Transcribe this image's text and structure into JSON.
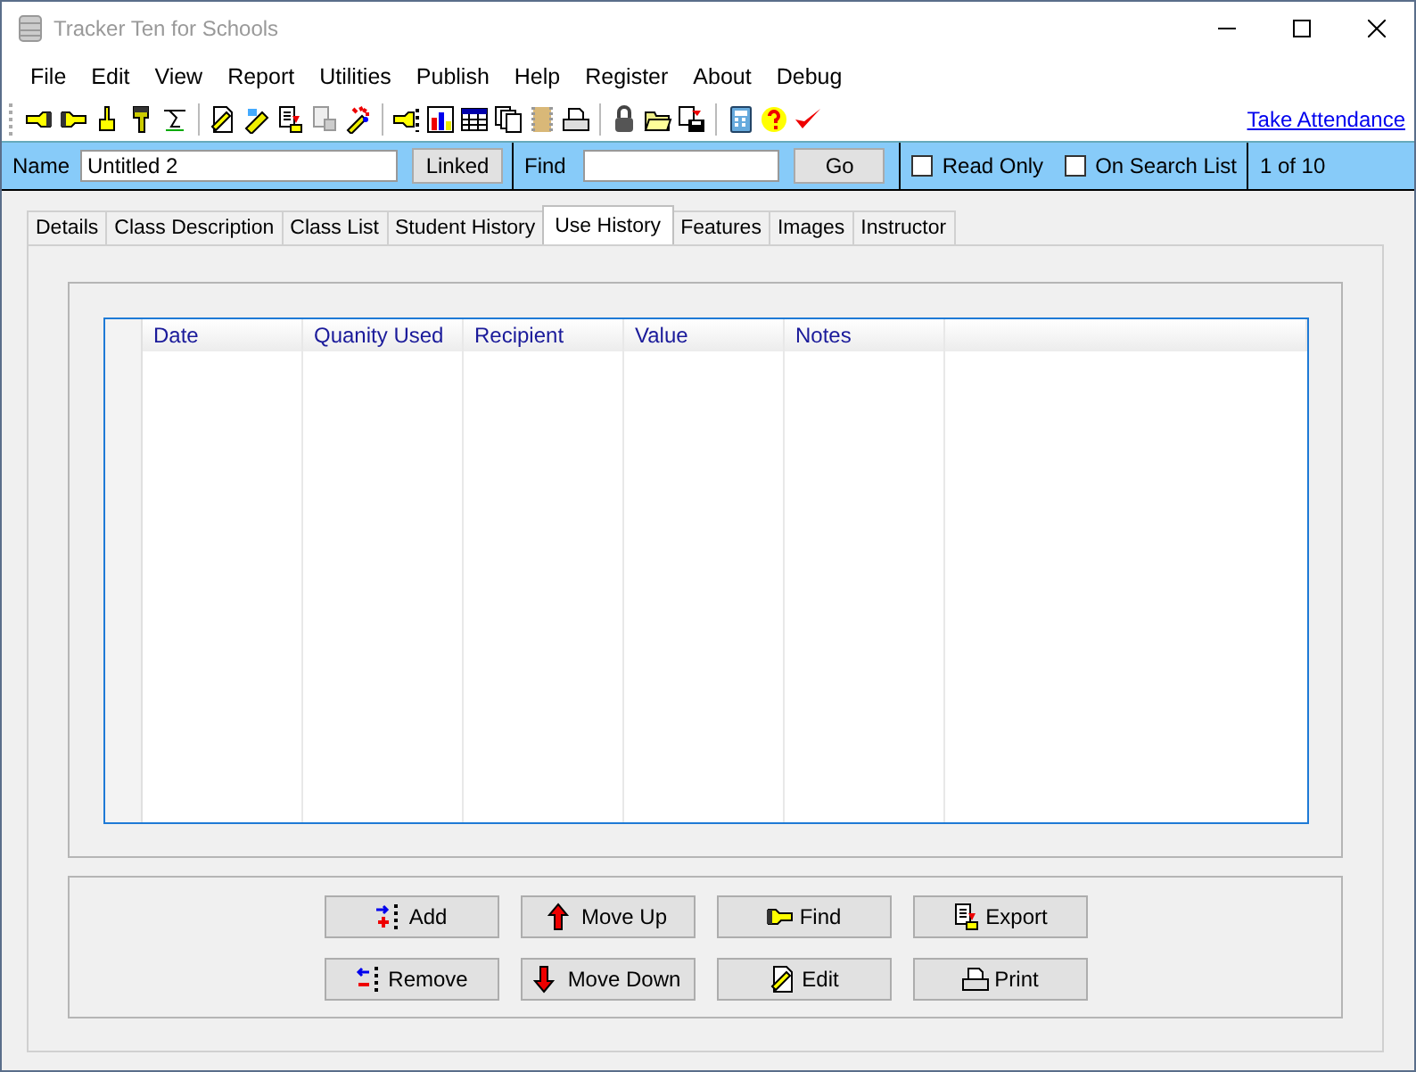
{
  "window": {
    "title": "Tracker Ten for Schools"
  },
  "menu": [
    "File",
    "Edit",
    "View",
    "Report",
    "Utilities",
    "Publish",
    "Help",
    "Register",
    "About",
    "Debug"
  ],
  "toolbar": {
    "link": "Take Attendance"
  },
  "record_bar": {
    "name_label": "Name",
    "name_value": "Untitled 2",
    "linked_button": "Linked",
    "find_label": "Find",
    "go_button": "Go",
    "checkboxes": [
      {
        "label": "Read Only",
        "checked": false
      },
      {
        "label": "On Search List",
        "checked": false
      }
    ],
    "record_count": "1 of 10"
  },
  "tabs": [
    {
      "label": "Details",
      "selected": false
    },
    {
      "label": "Class Description",
      "selected": false
    },
    {
      "label": "Class List",
      "selected": false
    },
    {
      "label": "Student History",
      "selected": false
    },
    {
      "label": "Use History",
      "selected": true
    },
    {
      "label": "Features",
      "selected": false
    },
    {
      "label": "Images",
      "selected": false
    },
    {
      "label": "Instructor",
      "selected": false
    }
  ],
  "table": {
    "columns": [
      "Date",
      "Quanity Used",
      "Recipient",
      "Value",
      "Notes"
    ]
  },
  "buttons": [
    {
      "label": "Add",
      "kind": "add"
    },
    {
      "label": "Move Up",
      "kind": "up"
    },
    {
      "label": "Find",
      "kind": "find"
    },
    {
      "label": "Export",
      "kind": "export"
    },
    {
      "label": "Remove",
      "kind": "remove"
    },
    {
      "label": "Move Down",
      "kind": "down"
    },
    {
      "label": "Edit",
      "kind": "edit"
    },
    {
      "label": "Print",
      "kind": "print"
    }
  ]
}
